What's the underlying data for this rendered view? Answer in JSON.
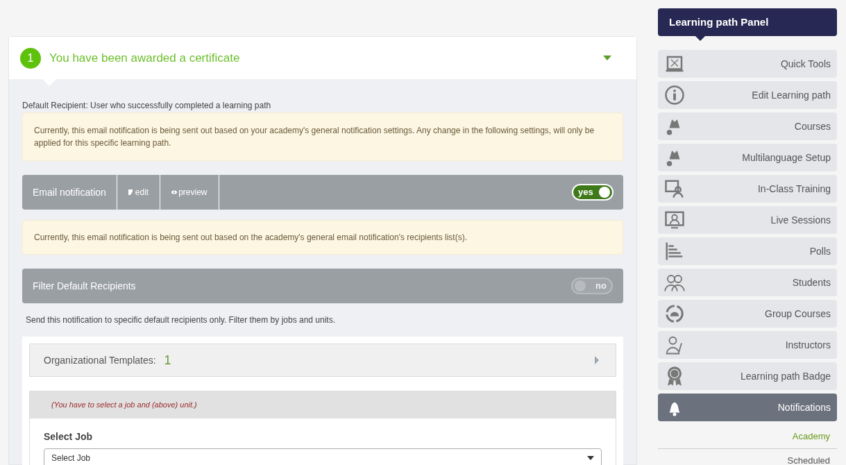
{
  "notification": {
    "number": "1",
    "title": "You have been awarded a certificate",
    "expanded": true,
    "default_recipient": "Default Recipient: User who successfully completed a learning path",
    "notice_settings": "Currently, this email notification is being sent out based on your academy's general notification settings. Any change in the following settings, will only be applied for this specific learning path.",
    "email_bar": {
      "label": "Email notification",
      "actions": [
        "edit",
        "preview"
      ],
      "toggle": {
        "on": true,
        "text": "yes"
      }
    },
    "notice_recipients": "Currently, this email notification is being sent out based on the academy's general email notification's recipients list(s).",
    "filter_bar": {
      "label": "Filter Default Recipients",
      "toggle": {
        "on": false,
        "text": "no"
      }
    },
    "filter_hint": "Send this notification to specific default recipients only. Filter them by jobs and units.",
    "templates": {
      "label": "Organizational Templates:",
      "count": "1",
      "expanded": false
    },
    "warning": "(You have to select a job and (above) unit.)",
    "job": {
      "label": "Select Job",
      "value": "Select Job"
    }
  },
  "panel": {
    "title": "Learning path Panel",
    "items": [
      {
        "label": "Quick Tools",
        "selected": false
      },
      {
        "label": "Edit Learning path",
        "selected": false
      },
      {
        "label": "Courses",
        "selected": false
      },
      {
        "label": "Multilanguage Setup",
        "selected": false
      },
      {
        "label": "In-Class Training",
        "selected": false
      },
      {
        "label": "Live Sessions",
        "selected": false
      },
      {
        "label": "Polls",
        "selected": false
      },
      {
        "label": "Students",
        "selected": false
      },
      {
        "label": "Group Courses",
        "selected": false
      },
      {
        "label": "Instructors",
        "selected": false
      },
      {
        "label": "Learning path Badge",
        "selected": false
      },
      {
        "label": "Notifications",
        "selected": true
      }
    ],
    "subitems": [
      {
        "label": "Academy",
        "selected": true
      },
      {
        "label": "Scheduled",
        "selected": false
      }
    ]
  }
}
